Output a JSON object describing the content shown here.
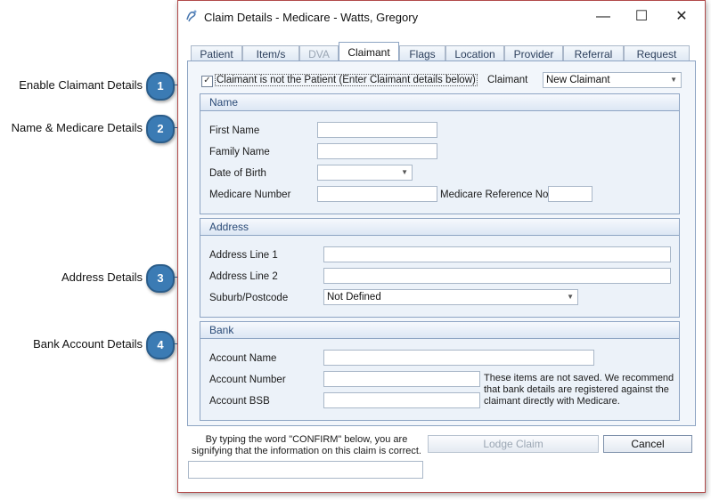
{
  "callouts": [
    {
      "num": "1",
      "label": "Enable Claimant Details"
    },
    {
      "num": "2",
      "label": "Name & Medicare Details"
    },
    {
      "num": "3",
      "label": "Address Details"
    },
    {
      "num": "4",
      "label": "Bank Account Details"
    }
  ],
  "window": {
    "title": "Claim Details - Medicare - Watts, Gregory",
    "minimize": "—",
    "maximize": "☐",
    "close": "✕"
  },
  "tabs": [
    "Patient",
    "Item/s",
    "DVA",
    "Claimant",
    "Flags",
    "Location",
    "Provider",
    "Referral",
    "Request"
  ],
  "active_tab": "Claimant",
  "claimant_checkbox": {
    "checked": true,
    "label": "Claimant is not the Patient (Enter Claimant details below)"
  },
  "claimant_select": {
    "label": "Claimant",
    "value": "New Claimant"
  },
  "name_group": {
    "title": "Name",
    "first_name": "First Name",
    "family_name": "Family Name",
    "dob": "Date of Birth",
    "medicare_number": "Medicare Number",
    "medicare_ref": "Medicare Reference No."
  },
  "address_group": {
    "title": "Address",
    "line1": "Address Line 1",
    "line2": "Address Line 2",
    "suburb": "Suburb/Postcode",
    "suburb_value": "Not Defined"
  },
  "bank_group": {
    "title": "Bank",
    "account_name": "Account Name",
    "account_number": "Account Number",
    "account_bsb": "Account BSB",
    "note": "These items are not saved. We recommend that bank details are registered against the claimant directly with Medicare."
  },
  "footer": {
    "confirm_text": "By typing the word \"CONFIRM\" below, you are signifying that the information on this claim is correct.",
    "lodge": "Lodge Claim",
    "cancel": "Cancel"
  }
}
